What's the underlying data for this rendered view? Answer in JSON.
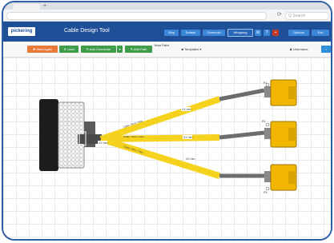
{
  "browser": {
    "tab_title": "",
    "new_tab": "+",
    "url": "",
    "search_placeholder": "Q Search",
    "reload_icon": "reload-icon"
  },
  "app": {
    "logo": "pickering",
    "title": "Cable Design Tool",
    "header_buttons": [
      "Stop",
      "Default",
      "Overmold",
      "Wrapping"
    ],
    "header_icons": [
      "gear-icon",
      "help-icon",
      "flag-icon"
    ],
    "header_right": [
      "Options",
      "Exit"
    ]
  },
  "toolbar": {
    "start_again": "✚ Start Again",
    "load": "⬇ Load",
    "add_connector": "✎ Add Connector",
    "connector_menu": "▾",
    "add_path": "✎ Add Path",
    "move_paths": "Move Paths",
    "templates": "■ Templates ▾",
    "user": "♟ Username",
    "info": "i"
  },
  "diagram": {
    "colors": {
      "cable_yellow": "#f5d21e",
      "cable_gray": "#6d6d6d",
      "connector_yellow": "#f2b705",
      "trunk": "#4a4a4a"
    },
    "main_labels": [
      "XX mm",
      "XX mm",
      "XX mm",
      "XX mm"
    ],
    "branch_labels": [
      "Cable / Wire / Tube",
      "Cable / Wire / Tube",
      "Cable / Wire / Tube"
    ],
    "connector_labels": [
      "P1",
      "P2",
      "P3",
      "P4"
    ]
  }
}
